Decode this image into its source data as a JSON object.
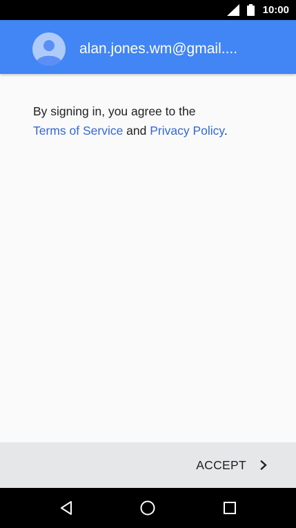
{
  "status_bar": {
    "time": "10:00",
    "icons": [
      "signal-icon",
      "battery-icon"
    ]
  },
  "account": {
    "email": "alan.jones.wm@gmail....",
    "avatar_icon": "person-icon"
  },
  "terms": {
    "line1": "By signing in, you agree to the",
    "terms_link": "Terms of Service",
    "conjunction": " and ",
    "privacy_link": "Privacy Policy",
    "end": "."
  },
  "actions": {
    "accept_label": "ACCEPT",
    "accept_icon": "chevron-right-icon"
  },
  "navigation": {
    "back_icon": "back-icon",
    "home_icon": "home-icon",
    "recents_icon": "recents-icon"
  },
  "colors": {
    "header": "#4285f4",
    "link": "#3367d6",
    "action_bar": "#e6e7e9",
    "background": "#fafafa"
  }
}
